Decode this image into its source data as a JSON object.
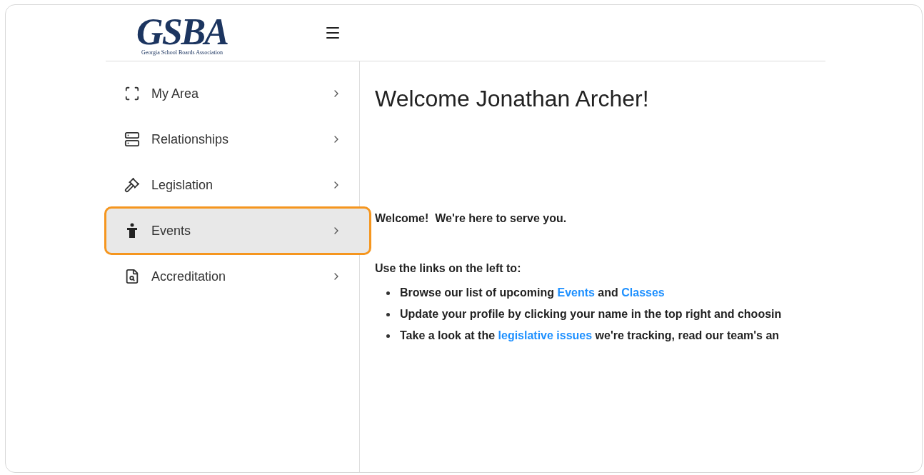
{
  "header": {
    "logo_text": "GSBA",
    "logo_subtitle": "Georgia School Boards Association"
  },
  "sidebar": {
    "items": [
      {
        "label": "My Area",
        "kind": "area",
        "selected": false
      },
      {
        "label": "Relationships",
        "kind": "stack",
        "selected": false
      },
      {
        "label": "Legislation",
        "kind": "gavel",
        "selected": false
      },
      {
        "label": "Events",
        "kind": "podium",
        "selected": true
      },
      {
        "label": "Accreditation",
        "kind": "document",
        "selected": false
      }
    ]
  },
  "main": {
    "title": "Welcome Jonathan Archer!",
    "intro": "Welcome!  We're here to serve you.",
    "lead": "Use the links on the left to:",
    "bullets": [
      [
        {
          "kind": "text",
          "text": "Browse our list of upcoming "
        },
        {
          "kind": "link",
          "text": "Events"
        },
        {
          "kind": "text",
          "text": " and "
        },
        {
          "kind": "link",
          "text": "Classes"
        }
      ],
      [
        {
          "kind": "text",
          "text": "Update your profile by clicking your name in the top right and choosin"
        }
      ],
      [
        {
          "kind": "text",
          "text": "Take a look at the "
        },
        {
          "kind": "link",
          "text": "legislative issues"
        },
        {
          "kind": "text",
          "text": " we're tracking, read our team's an"
        }
      ]
    ]
  }
}
